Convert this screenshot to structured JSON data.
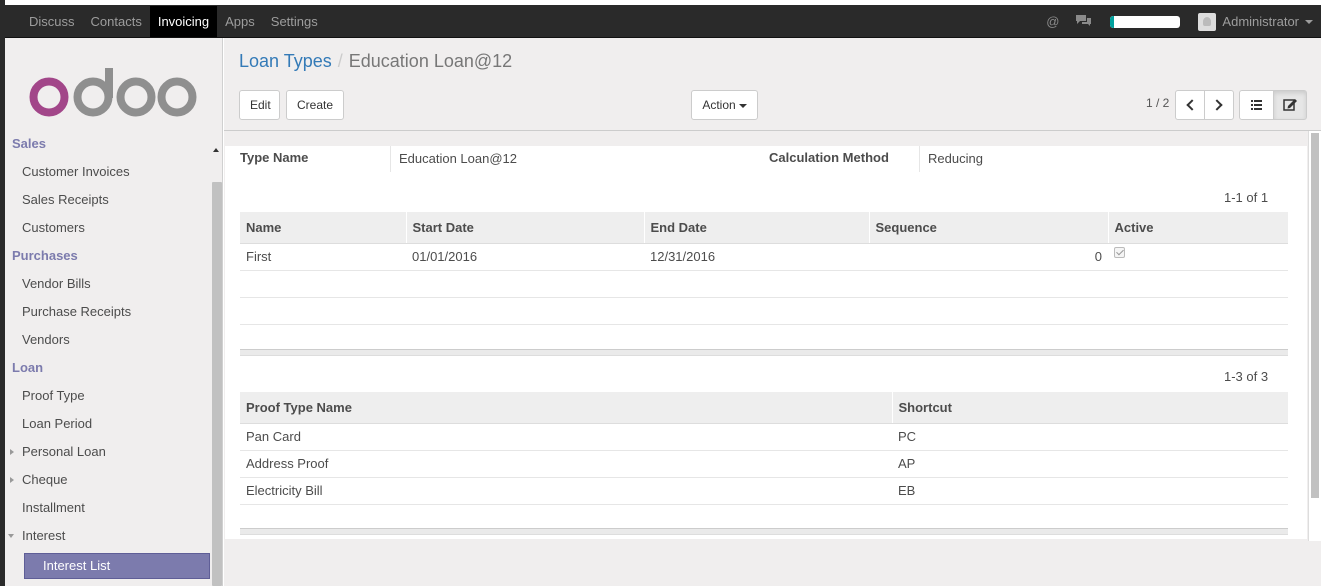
{
  "topbar": {
    "menu": [
      "Discuss",
      "Contacts",
      "Invoicing",
      "Apps",
      "Settings"
    ],
    "active_menu": "Invoicing",
    "user": "Administrator",
    "progress_fraction": 0.05
  },
  "sidebar": {
    "logo_text": "odoo",
    "sections": [
      {
        "type": "cat",
        "label": "Sales"
      },
      {
        "type": "item",
        "label": "Customer Invoices"
      },
      {
        "type": "item",
        "label": "Sales Receipts"
      },
      {
        "type": "item",
        "label": "Customers"
      },
      {
        "type": "cat",
        "label": "Purchases"
      },
      {
        "type": "item",
        "label": "Vendor Bills"
      },
      {
        "type": "item",
        "label": "Purchase Receipts"
      },
      {
        "type": "item",
        "label": "Vendors"
      },
      {
        "type": "cat",
        "label": "Loan"
      },
      {
        "type": "item",
        "label": "Proof Type"
      },
      {
        "type": "item",
        "label": "Loan Period"
      },
      {
        "type": "item",
        "label": "Personal Loan",
        "expand": "right"
      },
      {
        "type": "item",
        "label": "Cheque",
        "expand": "right"
      },
      {
        "type": "item",
        "label": "Installment"
      },
      {
        "type": "item",
        "label": "Interest",
        "expand": "down"
      },
      {
        "type": "active",
        "label": "Interest List"
      }
    ]
  },
  "breadcrumb": {
    "parent": "Loan Types",
    "separator": "/",
    "current": "Education Loan@12"
  },
  "buttons": {
    "edit": "Edit",
    "create": "Create",
    "action": "Action"
  },
  "pager": {
    "value": "1 / 2"
  },
  "form": {
    "type_name_label": "Type Name",
    "type_name_value": "Education Loan@12",
    "calc_method_label": "Calculation Method",
    "calc_method_value": "Reducing"
  },
  "periods": {
    "count": "1-1 of 1",
    "headers": [
      "Name",
      "Start Date",
      "End Date",
      "Sequence",
      "Active"
    ],
    "rows": [
      {
        "name": "First",
        "start": "01/01/2016",
        "end": "12/31/2016",
        "sequence": "0",
        "active": true
      }
    ]
  },
  "proofs": {
    "count": "1-3 of 3",
    "headers": [
      "Proof Type Name",
      "Shortcut"
    ],
    "rows": [
      {
        "name": "Pan Card",
        "shortcut": "PC"
      },
      {
        "name": "Address Proof",
        "shortcut": "AP"
      },
      {
        "name": "Electricity Bill",
        "shortcut": "EB"
      }
    ]
  },
  "colors": {
    "brand": "#7c7bad",
    "link": "#337ab7",
    "navbar": "#2a2a2a"
  }
}
